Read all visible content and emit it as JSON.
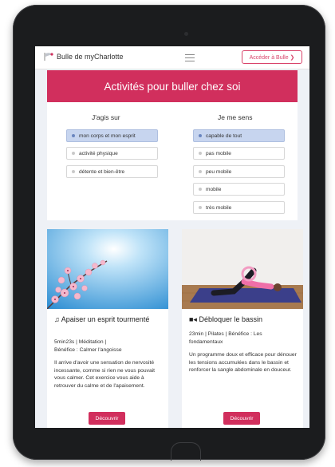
{
  "header": {
    "brand": "Bulle de myCharlotte",
    "access_button": "Accéder à Bulle ❯"
  },
  "banner": {
    "title": "Activités pour buller chez soi"
  },
  "filters": {
    "left": {
      "title": "J'agis sur",
      "options": [
        "mon corps et mon esprit",
        "activité physique",
        "détente et bien-être"
      ],
      "selected": 0
    },
    "right": {
      "title": "Je me sens",
      "options": [
        "capable de tout",
        "pas mobile",
        "peu mobile",
        "mobile",
        "très mobile"
      ],
      "selected": 0
    }
  },
  "cards": [
    {
      "icon": "music-note-icon",
      "title": "Apaiser un esprit tourmenté",
      "meta1": "5min23s | Méditation |",
      "meta2": "Bénéfice : Calmer l'angoisse",
      "description": "Il arrive d'avoir une sensation de nervosité incessante, comme si rien ne vous pouvait vous calmer. Cet exercice vous aide à retrouver du calme et de l'apaisement.",
      "button": "Découvrir"
    },
    {
      "icon": "video-camera-icon",
      "title": "Débloquer le bassin",
      "meta1": "23min | Pilates | Bénéfice : Les",
      "meta2": "fondamentaux",
      "description": "Un programme doux et efficace pour dénouer les tensions accumulées dans le bassin et renforcer la sangle abdominale en douceur.",
      "button": "Découvrir"
    }
  ],
  "colors": {
    "accent": "#d12f5d",
    "selected": "#c7d5ef",
    "background": "#eef1f6"
  }
}
